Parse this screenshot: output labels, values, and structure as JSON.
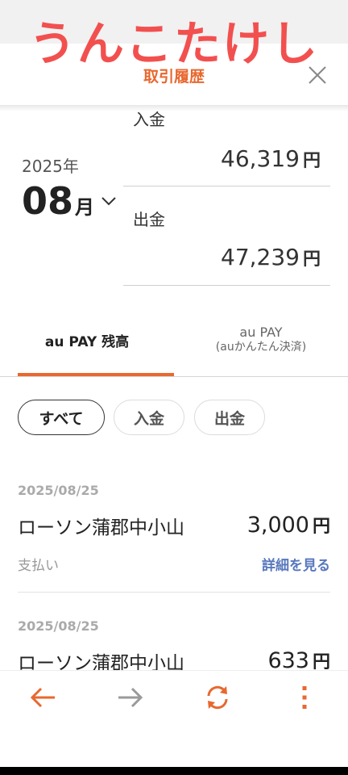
{
  "overlay": {
    "watermark_text": "うんこたけし"
  },
  "header": {
    "title": "取引履歴",
    "close_icon": "close-icon"
  },
  "period": {
    "year": "2025年",
    "month": "08",
    "month_unit": "月"
  },
  "summary": {
    "deposit_label": "入金",
    "deposit_amount": "46,319",
    "withdrawal_label": "出金",
    "withdrawal_amount": "47,239",
    "currency": "円"
  },
  "tabs": [
    {
      "label": "au PAY 残高",
      "active": true
    },
    {
      "label": "au PAY",
      "sub": "(auかんたん決済)",
      "active": false
    }
  ],
  "filters": [
    {
      "label": "すべて",
      "selected": true
    },
    {
      "label": "入金",
      "selected": false
    },
    {
      "label": "出金",
      "selected": false
    }
  ],
  "transactions": [
    {
      "date": "2025/08/25",
      "name": "ローソン蒲郡中小山",
      "amount": "3,000",
      "currency": "円",
      "type": "支払い",
      "link": "詳細を見る"
    },
    {
      "date": "2025/08/25",
      "name": "ローソン蒲郡中小山",
      "amount": "633",
      "currency": "円"
    }
  ],
  "nav": {
    "icons": [
      "back-arrow-icon",
      "forward-arrow-icon",
      "refresh-icon",
      "more-vertical-icon"
    ],
    "accent_color": "#e8682f",
    "disabled_color": "#9a9a9a"
  }
}
